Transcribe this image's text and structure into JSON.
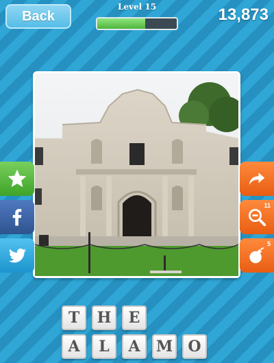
{
  "header": {
    "back_label": "Back",
    "level_label": "Level 15",
    "progress_fraction": 0.6,
    "score": "13,873"
  },
  "image": {
    "subject": "the-alamo-photo"
  },
  "left_buttons": {
    "star_icon": "star-icon",
    "facebook_icon": "facebook-icon",
    "twitter_icon": "twitter-icon"
  },
  "right_buttons": {
    "skip_icon": "arrow-right-icon",
    "zoom_icon": "magnify-minus-icon",
    "zoom_count": "11",
    "bomb_icon": "bomb-icon",
    "bomb_count": "5"
  },
  "answer": {
    "row1": [
      "T",
      "H",
      "E"
    ],
    "row2": [
      "A",
      "L",
      "A",
      "M",
      "O"
    ]
  },
  "colors": {
    "accent_orange": "#f26b1d",
    "accent_green": "#5cc143",
    "facebook_blue": "#3b5c9c",
    "twitter_blue": "#33aee6"
  }
}
